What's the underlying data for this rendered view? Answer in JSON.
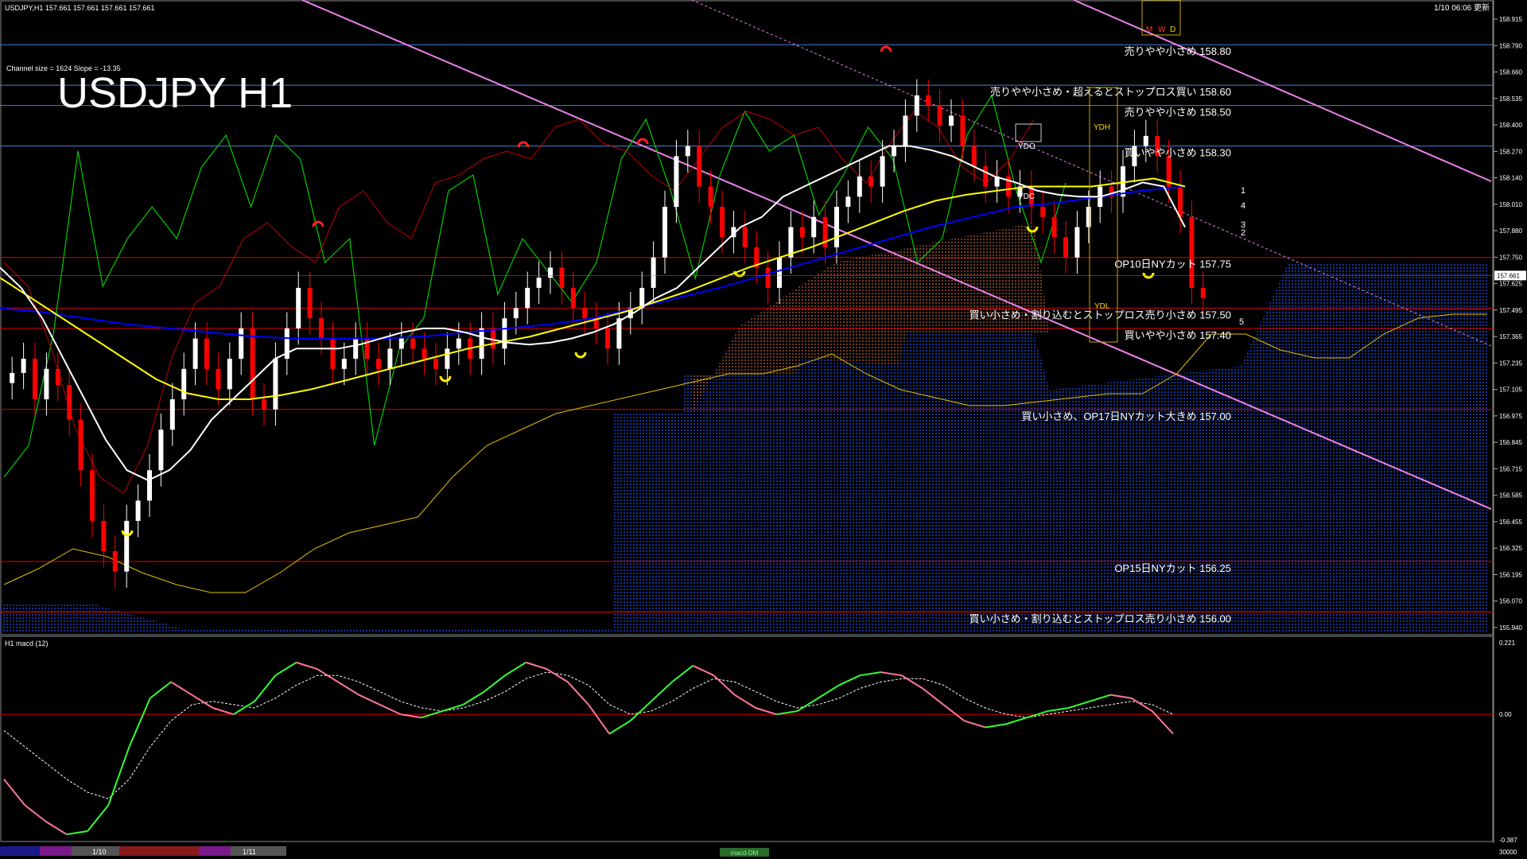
{
  "header": {
    "symbol_info": "USDJPY,H1  157.661 157.661 157.661 157.661",
    "update_time": "1/10 06:06 更新",
    "big_title": "USDJPY H1",
    "channel_info": "Channel size = 1624 Slope = -13.35"
  },
  "colors": {
    "background": "#000000",
    "bull_candle": "#ffffff",
    "bear_candle": "#ff0000",
    "level_blue": "#4a7fd4",
    "level_red": "#e00000",
    "trend_pink": "#ee82ee",
    "ma_white": "#ffffff",
    "ma_yellow": "#ffff00",
    "ma_blue": "#0000ff",
    "ichimoku_green": "#00cc00",
    "cloud_blue": "#1a3bb0",
    "macd_green": "#33ff33",
    "macd_pink": "#ff7799"
  },
  "price_axis": {
    "ticks": [
      "158.915",
      "158.790",
      "158.660",
      "158.535",
      "158.400",
      "158.270",
      "158.140",
      "158.010",
      "157.880",
      "157.750",
      "157.625",
      "157.495",
      "157.365",
      "157.235",
      "157.105",
      "156.975",
      "156.845",
      "156.715",
      "156.585",
      "156.455",
      "156.325",
      "156.195",
      "156.070",
      "155.940"
    ],
    "current_price": "157.661"
  },
  "levels": [
    {
      "label": "売りやや小さめ 158.80",
      "color": "blue"
    },
    {
      "label": "売りやや小さめ・超えるとストップロス買い 158.60",
      "color": "blue"
    },
    {
      "label": "売りやや小さめ 158.50",
      "color": "blue"
    },
    {
      "label": "買いやや小さめ 158.30",
      "color": "blue"
    },
    {
      "label": "OP10日NYカット 157.75",
      "color": "red"
    },
    {
      "label": "買い小さめ・割り込むとストップロス売り小さめ 157.50",
      "color": "red"
    },
    {
      "label": "買いやや小さめ 157.40",
      "color": "red"
    },
    {
      "label": "買い小さめ、OP17日NYカット大きめ 157.00",
      "color": "red"
    },
    {
      "label": "OP15日NYカット 156.25",
      "color": "red"
    },
    {
      "label": "買い小さめ・割り込むとストップロス売り小さめ 156.00",
      "color": "red"
    }
  ],
  "markers": {
    "ydh": "YDH",
    "ydo": "YDO",
    "ydc": "YDC",
    "ydl": "YDL",
    "mwd": [
      "M",
      "W",
      "D"
    ],
    "forecast_numbers": [
      "1",
      "4",
      "3",
      "2",
      "5"
    ]
  },
  "macd_panel": {
    "title": "H1  macd (12)",
    "axis_ticks": [
      "0.221",
      "0.00",
      "-0.387"
    ]
  },
  "time_axis": {
    "labels": [
      "1/10",
      "1/11"
    ],
    "right_label": "30000",
    "tab_label": "macd-DM"
  },
  "chart_data": {
    "type": "candlestick",
    "title": "USDJPY H1",
    "ylim": [
      155.9,
      158.95
    ],
    "close_series": [
      157.18,
      157.25,
      157.05,
      157.2,
      157.12,
      156.95,
      156.7,
      156.45,
      156.3,
      156.2,
      156.45,
      156.55,
      156.7,
      156.9,
      157.05,
      157.2,
      157.35,
      157.2,
      157.1,
      157.25,
      157.4,
      157.05,
      157.0,
      157.25,
      157.4,
      157.6,
      157.45,
      157.35,
      157.2,
      157.25,
      157.35,
      157.25,
      157.2,
      157.3,
      157.35,
      157.3,
      157.25,
      157.2,
      157.3,
      157.35,
      157.25,
      157.4,
      157.3,
      157.45,
      157.5,
      157.6,
      157.65,
      157.7,
      157.6,
      157.5,
      157.45,
      157.4,
      157.3,
      157.45,
      157.5,
      157.6,
      157.75,
      158.0,
      158.25,
      158.3,
      158.1,
      158.0,
      157.85,
      157.9,
      157.8,
      157.7,
      157.6,
      157.75,
      157.9,
      157.85,
      157.95,
      157.8,
      158.0,
      158.05,
      158.15,
      158.1,
      158.25,
      158.3,
      158.45,
      158.55,
      158.5,
      158.4,
      158.45,
      158.3,
      158.2,
      158.1,
      158.15,
      158.05,
      158.1,
      158.0,
      157.95,
      157.85,
      157.75,
      157.9,
      158.0,
      158.1,
      158.05,
      158.2,
      158.3,
      158.35,
      158.25,
      158.1,
      157.95,
      157.6,
      157.55
    ],
    "ma_white": [
      157.7,
      157.6,
      157.45,
      157.25,
      157.05,
      156.85,
      156.7,
      156.65,
      156.7,
      156.8,
      156.95,
      157.05,
      157.15,
      157.25,
      157.3,
      157.3,
      157.3,
      157.32,
      157.35,
      157.38,
      157.4,
      157.4,
      157.38,
      157.35,
      157.33,
      157.32,
      157.33,
      157.35,
      157.38,
      157.42,
      157.48,
      157.55,
      157.6,
      157.7,
      157.8,
      157.9,
      157.95,
      158.05,
      158.1,
      158.15,
      158.2,
      158.25,
      158.3,
      158.3,
      158.28,
      158.25,
      158.2,
      158.15,
      158.12,
      158.08,
      158.06,
      158.05,
      158.05,
      158.08,
      158.12,
      158.1,
      157.9
    ],
    "ma_yellow": [
      157.65,
      157.55,
      157.45,
      157.35,
      157.25,
      157.15,
      157.08,
      157.05,
      157.05,
      157.07,
      157.1,
      157.14,
      157.18,
      157.22,
      157.26,
      157.3,
      157.33,
      157.36,
      157.4,
      157.44,
      157.48,
      157.53,
      157.58,
      157.64,
      157.7,
      157.75,
      157.8,
      157.86,
      157.92,
      157.98,
      158.03,
      158.06,
      158.08,
      158.1,
      158.1,
      158.1,
      158.12,
      158.14,
      158.1
    ],
    "ma_blue": [
      157.5,
      157.48,
      157.45,
      157.42,
      157.4,
      157.38,
      157.36,
      157.35,
      157.35,
      157.35,
      157.36,
      157.38,
      157.4,
      157.42,
      157.45,
      157.5,
      157.55,
      157.6,
      157.66,
      157.72,
      157.78,
      157.84,
      157.9,
      157.95,
      158.0,
      158.02,
      158.05,
      158.08,
      158.1
    ],
    "macd": [
      -0.2,
      -0.28,
      -0.33,
      -0.37,
      -0.36,
      -0.28,
      -0.1,
      0.05,
      0.1,
      0.06,
      0.02,
      0.0,
      0.04,
      0.12,
      0.16,
      0.14,
      0.1,
      0.06,
      0.03,
      0.0,
      -0.01,
      0.01,
      0.03,
      0.07,
      0.12,
      0.16,
      0.14,
      0.1,
      0.03,
      -0.06,
      -0.02,
      0.04,
      0.1,
      0.15,
      0.12,
      0.06,
      0.02,
      0.0,
      0.01,
      0.05,
      0.09,
      0.12,
      0.13,
      0.12,
      0.08,
      0.03,
      -0.02,
      -0.04,
      -0.03,
      -0.01,
      0.01,
      0.02,
      0.04,
      0.06,
      0.05,
      0.01,
      -0.06
    ],
    "macd_signal": [
      -0.05,
      -0.1,
      -0.15,
      -0.2,
      -0.24,
      -0.26,
      -0.2,
      -0.1,
      -0.02,
      0.03,
      0.04,
      0.03,
      0.02,
      0.05,
      0.09,
      0.12,
      0.12,
      0.1,
      0.07,
      0.04,
      0.02,
      0.01,
      0.02,
      0.04,
      0.07,
      0.11,
      0.13,
      0.12,
      0.09,
      0.03,
      0.0,
      0.01,
      0.04,
      0.08,
      0.11,
      0.1,
      0.07,
      0.04,
      0.02,
      0.03,
      0.05,
      0.08,
      0.1,
      0.11,
      0.11,
      0.09,
      0.05,
      0.02,
      0.0,
      -0.01,
      0.0,
      0.01,
      0.02,
      0.03,
      0.04,
      0.03,
      0.0
    ],
    "macd_ylim": [
      -0.387,
      0.221
    ]
  }
}
